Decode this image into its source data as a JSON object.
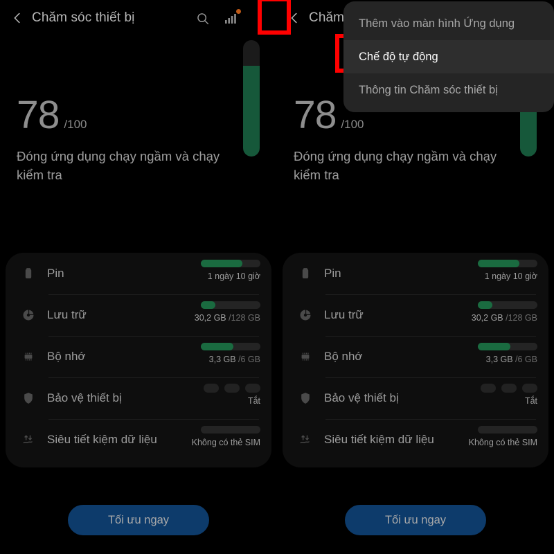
{
  "appbar": {
    "title_full": "Chăm sóc thiết bị",
    "title_truncated": "Chăm",
    "back_icon": "chevron-left-icon",
    "search_icon": "search-icon",
    "signal_icon": "signal-bars-icon",
    "menu_icon": "overflow-menu-icon"
  },
  "score": {
    "value": "78",
    "denominator": "/100",
    "description": "Đóng ứng dụng chạy ngầm và chạy kiểm tra",
    "percent": 78
  },
  "card": {
    "rows": [
      {
        "icon": "battery-icon",
        "label": "Pin",
        "value": "1 ngày 10 giờ",
        "value_dim": "",
        "bar_percent": 70,
        "type": "bar"
      },
      {
        "icon": "pie-chart-icon",
        "label": "Lưu trữ",
        "value": "30,2 GB ",
        "value_dim": "/128 GB",
        "bar_percent": 24,
        "type": "bar"
      },
      {
        "icon": "memory-chip-icon",
        "label": "Bộ nhớ",
        "value": "3,3 GB ",
        "value_dim": "/6 GB",
        "bar_percent": 55,
        "type": "bar"
      },
      {
        "icon": "shield-icon",
        "label": "Bảo vệ thiết bị",
        "value": "Tắt",
        "value_dim": "",
        "bar_percent": 0,
        "type": "dots"
      },
      {
        "icon": "data-saver-icon",
        "label": "Siêu tiết kiệm dữ liệu",
        "value": "Không có thẻ SIM",
        "value_dim": "",
        "bar_percent": 0,
        "type": "empty"
      }
    ]
  },
  "cta": {
    "label": "Tối ưu ngay"
  },
  "menu": {
    "items": [
      {
        "label": "Thêm vào màn hình Ứng dụng",
        "selected": false
      },
      {
        "label": "Chế độ tự động",
        "selected": true
      },
      {
        "label": "Thông tin Chăm sóc thiết bị",
        "selected": false
      }
    ]
  },
  "colors": {
    "green": "#1a6b40",
    "green_dark": "#16583a",
    "cta_blue": "#0d3b6b",
    "highlight_red": "#ff0000",
    "badge_orange": "#c05a17"
  }
}
